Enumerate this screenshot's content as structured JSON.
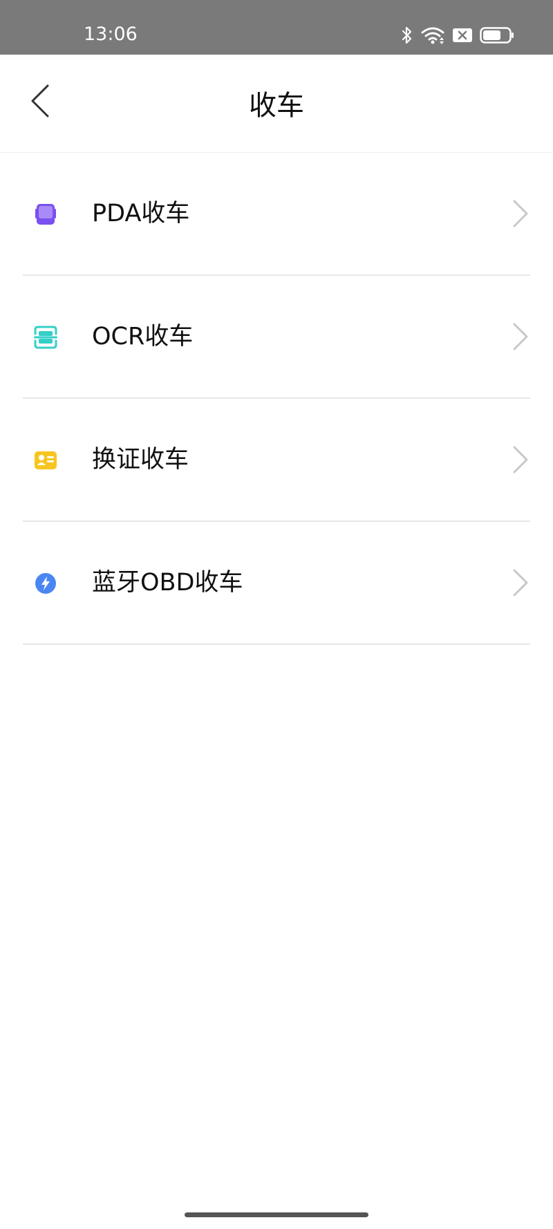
{
  "status_bar": {
    "time": "13:06",
    "icons": [
      "bluetooth-icon",
      "wifi-icon",
      "sim-disabled-icon",
      "battery-icon"
    ],
    "background_color": "#7a7a7a"
  },
  "nav_bar": {
    "title": "收车",
    "back_icon": "chevron-left-icon"
  },
  "menu": {
    "items": [
      {
        "id": "pda",
        "label": "PDA收车",
        "icon": "pda-device-icon",
        "icon_color": "#7b4ff0"
      },
      {
        "id": "ocr",
        "label": "OCR收车",
        "icon": "ocr-scan-icon",
        "icon_color": "#35cfc8"
      },
      {
        "id": "license",
        "label": "换证收车",
        "icon": "id-card-icon",
        "icon_color": "#f7c51e"
      },
      {
        "id": "obd",
        "label": "蓝牙OBD收车",
        "icon": "lightning-icon",
        "icon_color": "#4a86f2"
      }
    ],
    "chevron_icon": "chevron-right-icon"
  }
}
